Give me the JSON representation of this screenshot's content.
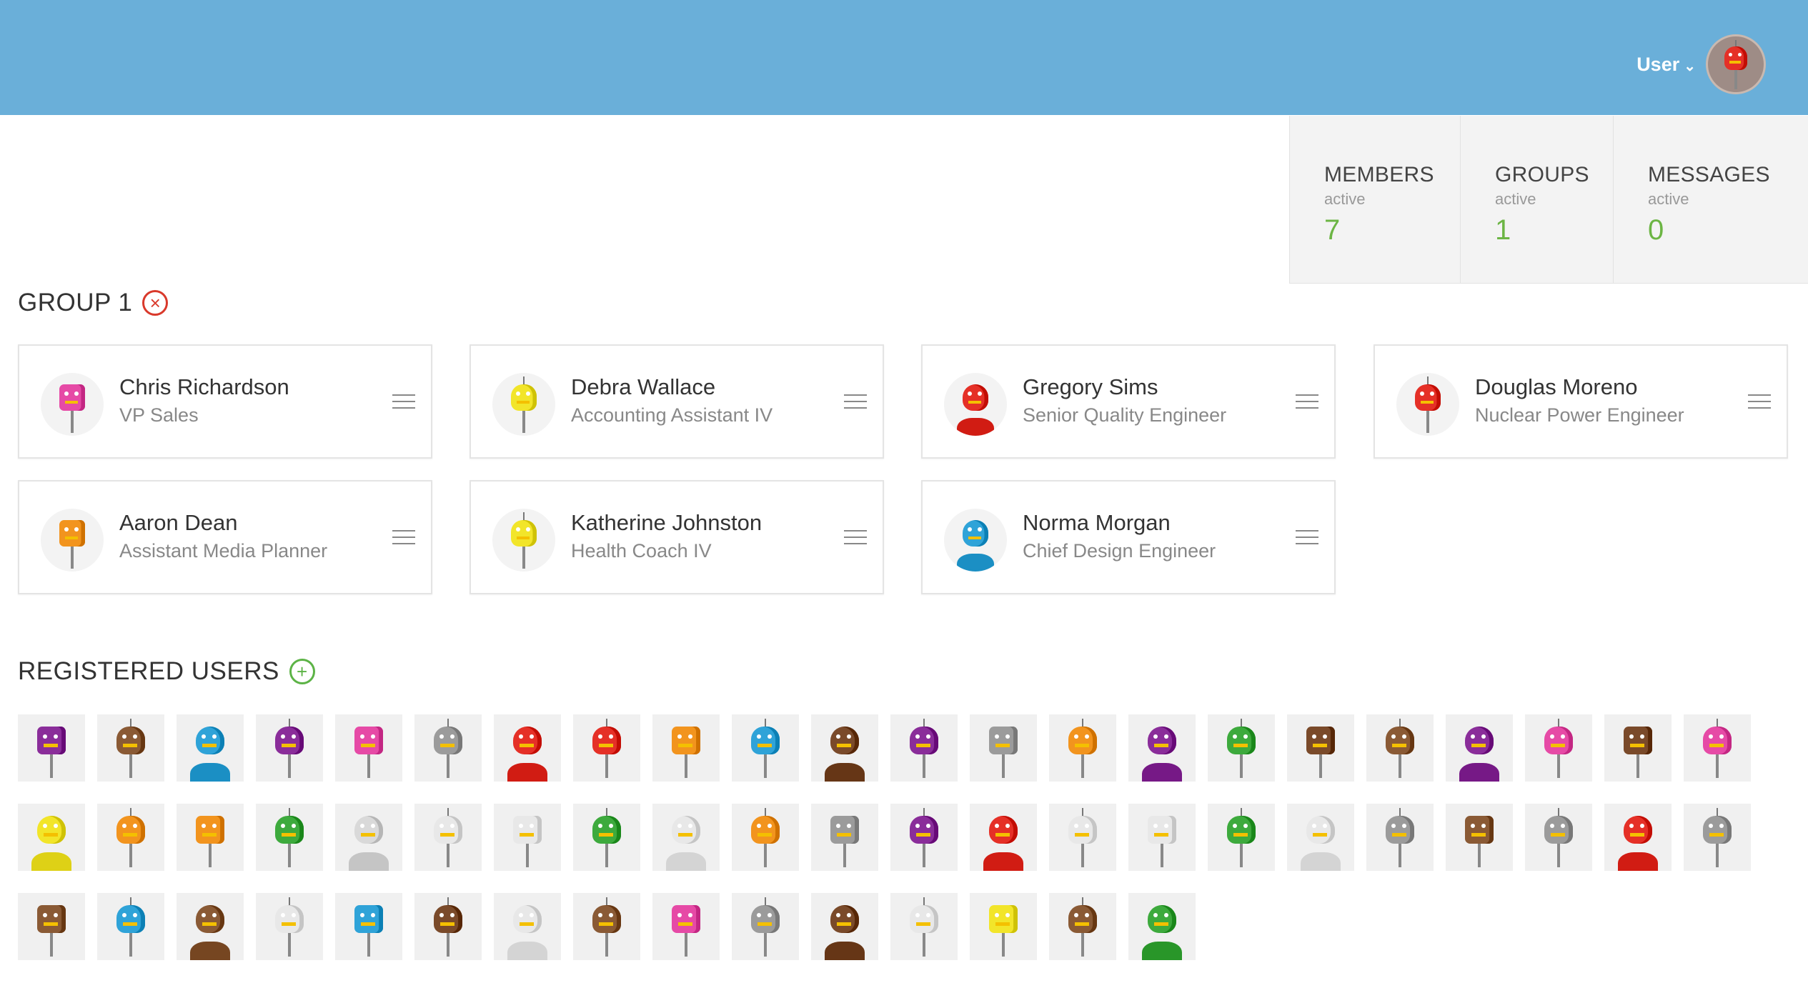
{
  "header": {
    "user_label": "User",
    "chevron_icon": "chevron-down-icon",
    "avatar_color": "#e53027",
    "bg_color": "#6aafd9"
  },
  "stats": [
    {
      "label": "MEMBERS",
      "sub": "active",
      "value": "7"
    },
    {
      "label": "GROUPS",
      "sub": "active",
      "value": "1"
    },
    {
      "label": "MESSAGES",
      "sub": "active",
      "value": "0"
    }
  ],
  "group": {
    "title": "GROUP 1",
    "remove_icon": "remove-circle-icon",
    "members": [
      {
        "name": "Chris Richardson",
        "role": "VP Sales",
        "color": "#e64aa6"
      },
      {
        "name": "Debra Wallace",
        "role": "Accounting Assistant IV",
        "color": "#f2e52a"
      },
      {
        "name": "Gregory Sims",
        "role": "Senior Quality Engineer",
        "color": "#e53027"
      },
      {
        "name": "Douglas Moreno",
        "role": "Nuclear Power Engineer",
        "color": "#e53027"
      },
      {
        "name": "Aaron Dean",
        "role": "Assistant Media Planner",
        "color": "#f2941e"
      },
      {
        "name": "Katherine Johnston",
        "role": "Health Coach IV",
        "color": "#f2e52a"
      },
      {
        "name": "Norma Morgan",
        "role": "Chief Design Engineer",
        "color": "#2fa3d8"
      }
    ]
  },
  "registered": {
    "title": "REGISTERED USERS",
    "add_icon": "add-circle-icon",
    "avatar_colors": [
      "#8a2d9a",
      "#8a5a35",
      "#2fa3d8",
      "#8a2d9a",
      "#e64aa6",
      "#9b9b9b",
      "#e53027",
      "#e53027",
      "#f2941e",
      "#2fa3d8",
      "#7a4a2a",
      "#8a2d9a",
      "#9b9b9b",
      "#f2941e",
      "#8a2d9a",
      "#3daa3d",
      "#7a4a2a",
      "#8a5a35",
      "#8a2d9a",
      "#e64aa6",
      "#7a4a2a",
      "#e64aa6",
      "#f2e52a",
      "#f2941e",
      "#f2941e",
      "#3daa3d",
      "#d9d9d9",
      "#e8e8e8",
      "#e8e8e8",
      "#3daa3d",
      "#e8e8e8",
      "#f2941e",
      "#9b9b9b",
      "#8a2d9a",
      "#e53027",
      "#e8e8e8",
      "#e8e8e8",
      "#3daa3d",
      "#e8e8e8",
      "#9b9b9b",
      "#8a5a35",
      "#9b9b9b",
      "#e53027",
      "#9b9b9b",
      "#8a5a35",
      "#2fa3d8",
      "#8a5a35",
      "#e8e8e8",
      "#2fa3d8",
      "#7a4a2a",
      "#e8e8e8",
      "#8a5a35",
      "#e64aa6",
      "#9b9b9b",
      "#7a4a2a",
      "#e8e8e8",
      "#f2e52a",
      "#8a5a35",
      "#3daa3d"
    ]
  }
}
